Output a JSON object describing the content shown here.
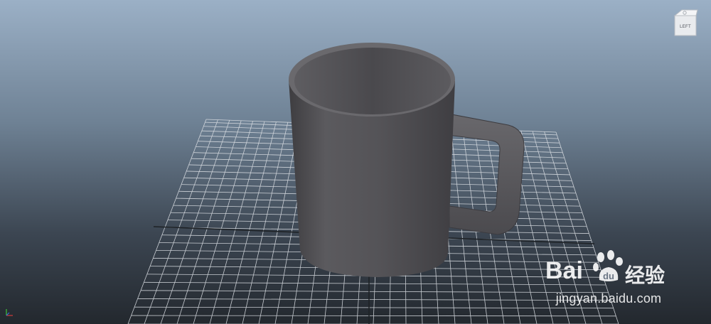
{
  "viewport": {
    "view_cube": {
      "face_label": "LEFT"
    },
    "object": "mug-model",
    "background_top": "#9bb0c6",
    "background_bottom": "#23282e",
    "grid_color": "#d9dde2",
    "axis_color": "#1e2226"
  },
  "watermark": {
    "brand": "Bai",
    "brand_cn": "经验",
    "url": "jingyan.baidu.com"
  }
}
